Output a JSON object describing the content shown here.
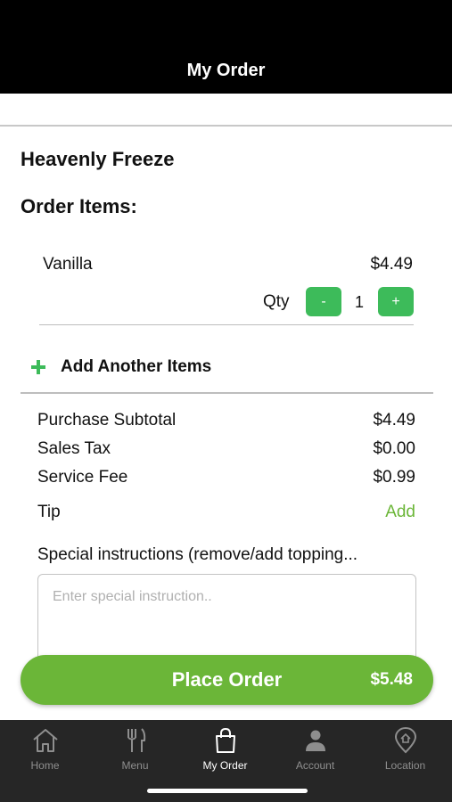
{
  "header": {
    "title": "My Order"
  },
  "store": {
    "name": "Heavenly Freeze"
  },
  "order": {
    "section_title": "Order Items:",
    "items": [
      {
        "name": "Vanilla",
        "price": "$4.49",
        "qty_label": "Qty",
        "qty": "1",
        "minus": "-",
        "plus": "+"
      }
    ],
    "add_more": {
      "icon": "plus-icon",
      "label": "Add Another Items"
    }
  },
  "summary": {
    "subtotal": {
      "label": "Purchase Subtotal",
      "value": "$4.49"
    },
    "tax": {
      "label": "Sales Tax",
      "value": "$0.00"
    },
    "fee": {
      "label": "Service Fee",
      "value": "$0.99"
    },
    "tip": {
      "label": "Tip",
      "action": "Add"
    }
  },
  "instructions": {
    "label": "Special instructions (remove/add topping...",
    "placeholder": "Enter special instruction.."
  },
  "place_order": {
    "label": "Place Order",
    "total": "$5.48"
  },
  "tabs": [
    {
      "label": "Home",
      "icon": "home-icon",
      "active": false
    },
    {
      "label": "Menu",
      "icon": "utensils-icon",
      "active": false
    },
    {
      "label": "My Order",
      "icon": "shopping-bag-icon",
      "active": true
    },
    {
      "label": "Account",
      "icon": "person-icon",
      "active": false
    },
    {
      "label": "Location",
      "icon": "location-pin-icon",
      "active": false
    }
  ],
  "colors": {
    "accent_green": "#6bb638",
    "qty_button_green": "#3dbb5a",
    "header_bg": "#000000",
    "tabbar_bg": "#262626"
  }
}
